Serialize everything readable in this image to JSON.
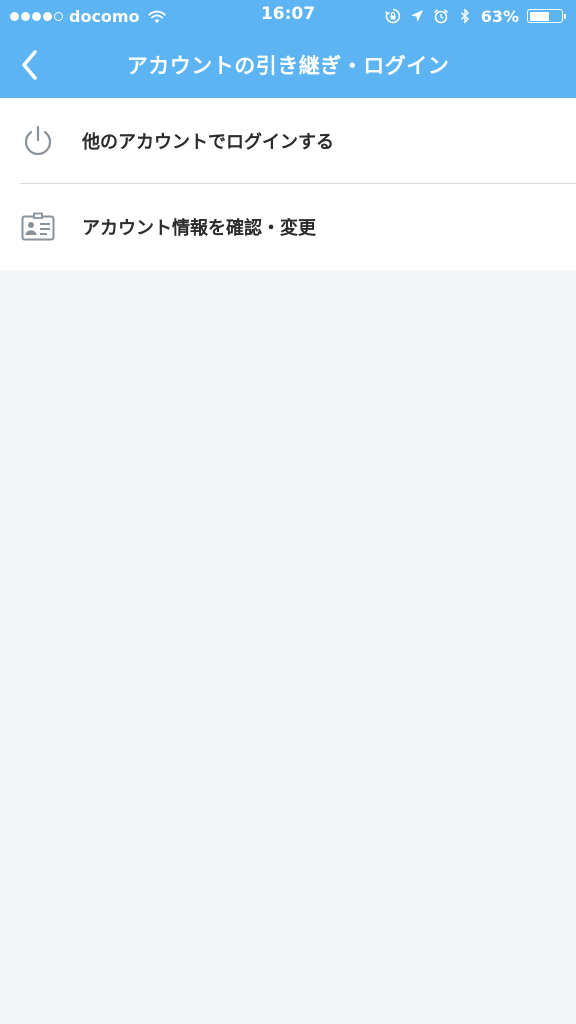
{
  "status_bar": {
    "carrier": "docomo",
    "time": "16:07",
    "battery_percent": "63%",
    "battery_level": 0.63,
    "signal_strength": 4,
    "signal_max": 5,
    "icons": [
      "wifi-icon",
      "orientation-lock-icon",
      "location-arrow-icon",
      "alarm-icon",
      "bluetooth-icon",
      "battery-icon"
    ]
  },
  "nav": {
    "title": "アカウントの引き継ぎ・ログイン",
    "back_icon": "chevron-left-icon"
  },
  "menu": {
    "items": [
      {
        "label": "他のアカウントでログインする",
        "icon": "power-icon"
      },
      {
        "label": "アカウント情報を確認・変更",
        "icon": "id-card-icon"
      }
    ]
  },
  "colors": {
    "header": "#5cb4f3",
    "background": "#f4f5f7",
    "list_background": "#ffffff",
    "text": "#2b2b2b",
    "icon": "#8a9299",
    "divider": "#d9d9d9"
  }
}
